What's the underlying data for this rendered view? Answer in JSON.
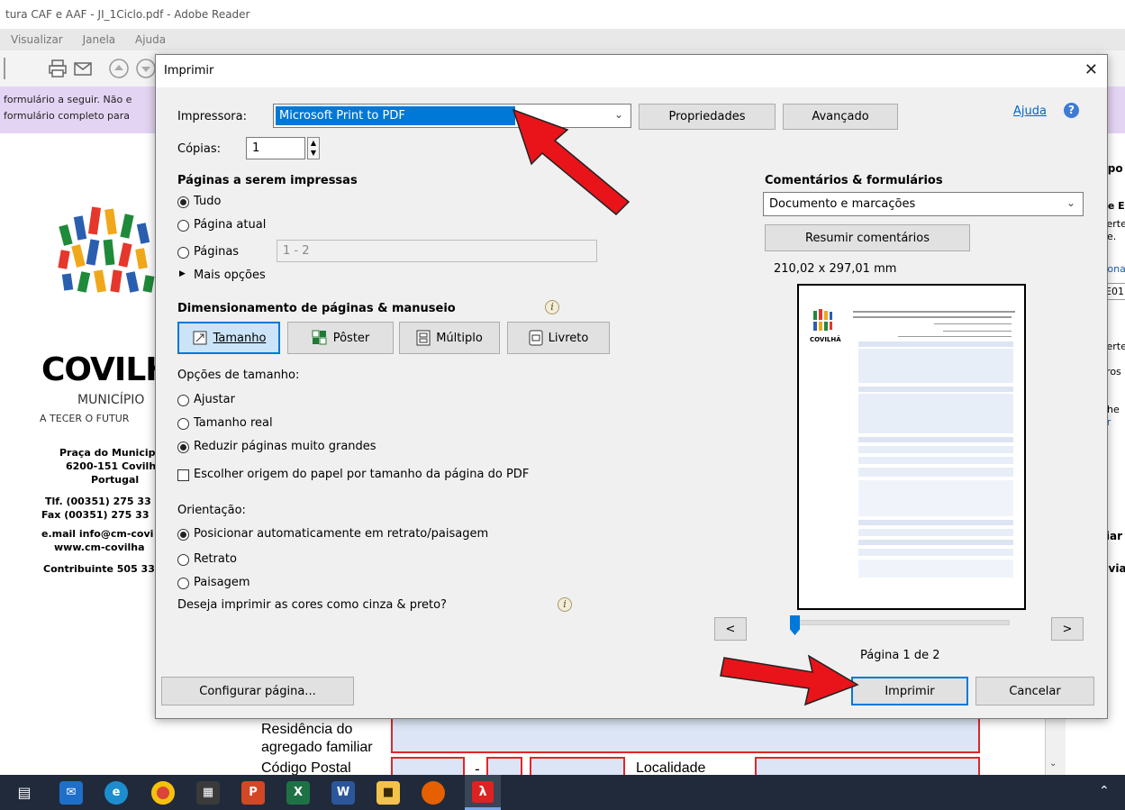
{
  "app": {
    "title": "tura CAF e AAF - JI_1Ciclo.pdf - Adobe Reader",
    "menu": [
      "Visualizar",
      "Janela",
      "Ajuda"
    ],
    "purple_bar": [
      "formulário a seguir. Não e",
      "formulário completo para"
    ],
    "doc_left": {
      "logo_text": "COVILH",
      "municipio": "MUNICÍPIO",
      "tagline": "A TECER O FUTUR",
      "address": [
        "Praça do Municip",
        "6200-151 Covilh",
        "Portugal"
      ],
      "phone": [
        "Tlf. (00351) 275 33",
        "Fax (00351) 275 33"
      ],
      "email": [
        "e.mail info@cm-covi",
        "www.cm-covilha"
      ],
      "contribuinte": "Contribuinte 505 33"
    },
    "right_panel": [
      "xpo",
      "be E",
      "verte",
      "ne.",
      "tiona",
      "E01",
      "verte",
      "cros",
      "nhe",
      "ar",
      "riar",
      "nvia"
    ],
    "form": {
      "residencia": "Residência do agregado familiar",
      "codigo_postal": "Código Postal",
      "dash": "-",
      "localidade": "Localidade"
    },
    "colors": {
      "accent": "#0078d7",
      "selected": "#0078d7",
      "purple": "#e4d4f4",
      "arrow": "#e8141a"
    }
  },
  "taskbar_icons": [
    "task-view-icon",
    "mail-icon",
    "edge-icon",
    "chrome-icon",
    "store-icon",
    "powerpoint-icon",
    "excel-icon",
    "word-icon",
    "file-explorer-icon",
    "firefox-icon",
    "acrobat-icon"
  ],
  "dialog": {
    "title": "Imprimir",
    "printer_label": "Impressora:",
    "printer_value": "Microsoft Print to PDF",
    "properties_btn": "Propriedades",
    "advanced_btn": "Avançado",
    "help_link": "Ajuda",
    "copies_label": "Cópias:",
    "copies_value": "1",
    "pages_heading": "Páginas a serem impressas",
    "pages_options": {
      "all": "Tudo",
      "current": "Página atual",
      "pages": "Páginas",
      "pages_value": "1 - 2",
      "more": "Mais opções"
    },
    "sizing_heading": "Dimensionamento de páginas & manuseio",
    "sizing_tabs": {
      "size": "Tamanho",
      "poster": "Pôster",
      "multiple": "Múltiplo",
      "booklet": "Livreto"
    },
    "size_options_label": "Opções de tamanho:",
    "size_options": {
      "fit": "Ajustar",
      "actual": "Tamanho real",
      "shrink": "Reduzir páginas muito grandes"
    },
    "paper_source_chk": "Escolher origem do papel por tamanho da página do PDF",
    "orientation_label": "Orientação:",
    "orientation_options": {
      "auto": "Posicionar automaticamente em retrato/paisagem",
      "portrait": "Retrato",
      "landscape": "Paisagem"
    },
    "grayscale_question": "Deseja imprimir as cores como cinza & preto?",
    "comments_heading": "Comentários & formulários",
    "comments_value": "Documento e marcações",
    "summarize_btn": "Resumir comentários",
    "page_size": "210,02 x 297,01 mm",
    "page_counter": "Página 1 de 2",
    "prev_btn": "<",
    "next_btn": ">",
    "page_setup_btn": "Configurar página...",
    "print_btn": "Imprimir",
    "cancel_btn": "Cancelar"
  }
}
